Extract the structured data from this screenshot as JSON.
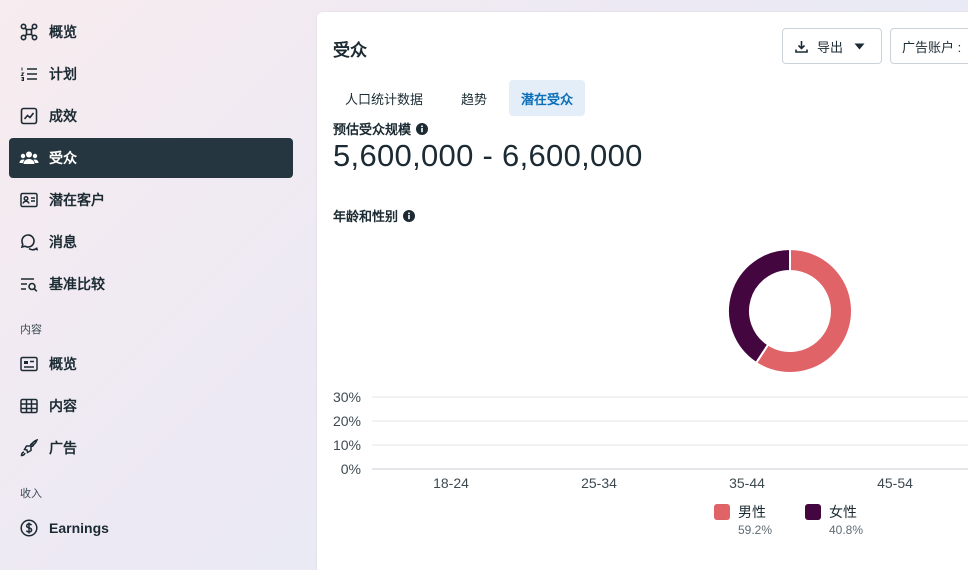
{
  "sidebar": {
    "items": [
      {
        "label": "概览",
        "icon": "overview-nodes-icon"
      },
      {
        "label": "计划",
        "icon": "numbered-list-icon"
      },
      {
        "label": "成效",
        "icon": "line-chart-icon"
      },
      {
        "label": "受众",
        "icon": "people-icon"
      },
      {
        "label": "潜在客户",
        "icon": "contact-card-icon"
      },
      {
        "label": "消息",
        "icon": "chat-bubble-icon"
      },
      {
        "label": "基准比较",
        "icon": "filter-search-icon"
      }
    ],
    "section_content": "内容",
    "content_items": [
      {
        "label": "概览",
        "icon": "dashboard-card-icon"
      },
      {
        "label": "内容",
        "icon": "table-grid-icon"
      },
      {
        "label": "广告",
        "icon": "rocket-icon"
      }
    ],
    "section_income": "收入",
    "income_items": [
      {
        "label": "Earnings",
        "icon": "dollar-circle-icon"
      }
    ],
    "active_index": 3
  },
  "header": {
    "title": "受众",
    "export_label": "导出",
    "account_label": "广告账户 :"
  },
  "tabs": [
    {
      "label": "人口统计数据"
    },
    {
      "label": "趋势"
    },
    {
      "label": "潜在受众"
    }
  ],
  "active_tab": 2,
  "audience": {
    "size_label": "预估受众规模",
    "size_value": "5,600,000 - 6,600,000",
    "age_gender_label": "年龄和性别"
  },
  "colors": {
    "male": "#e06368",
    "female": "#44063f",
    "sidebar_active": "#263640",
    "tab_active_bg": "#e3eef8",
    "tab_active_text": "#0a6fb8"
  },
  "chart_data": [
    {
      "type": "pie",
      "series": [
        {
          "name": "男性",
          "value": 59.2
        },
        {
          "name": "女性",
          "value": 40.8
        }
      ]
    },
    {
      "type": "bar",
      "categories": [
        "18-24",
        "25-34",
        "35-44",
        "45-54"
      ],
      "series": [
        {
          "name": "男性",
          "values": [
            0,
            0,
            0,
            0
          ]
        },
        {
          "name": "女性",
          "values": [
            0,
            0,
            0,
            0
          ]
        }
      ],
      "yticks": [
        "30%",
        "20%",
        "10%",
        "0%"
      ],
      "ylim": [
        0,
        30
      ]
    }
  ],
  "legend": [
    {
      "name": "男性",
      "pct": "59.2%"
    },
    {
      "name": "女性",
      "pct": "40.8%"
    }
  ]
}
